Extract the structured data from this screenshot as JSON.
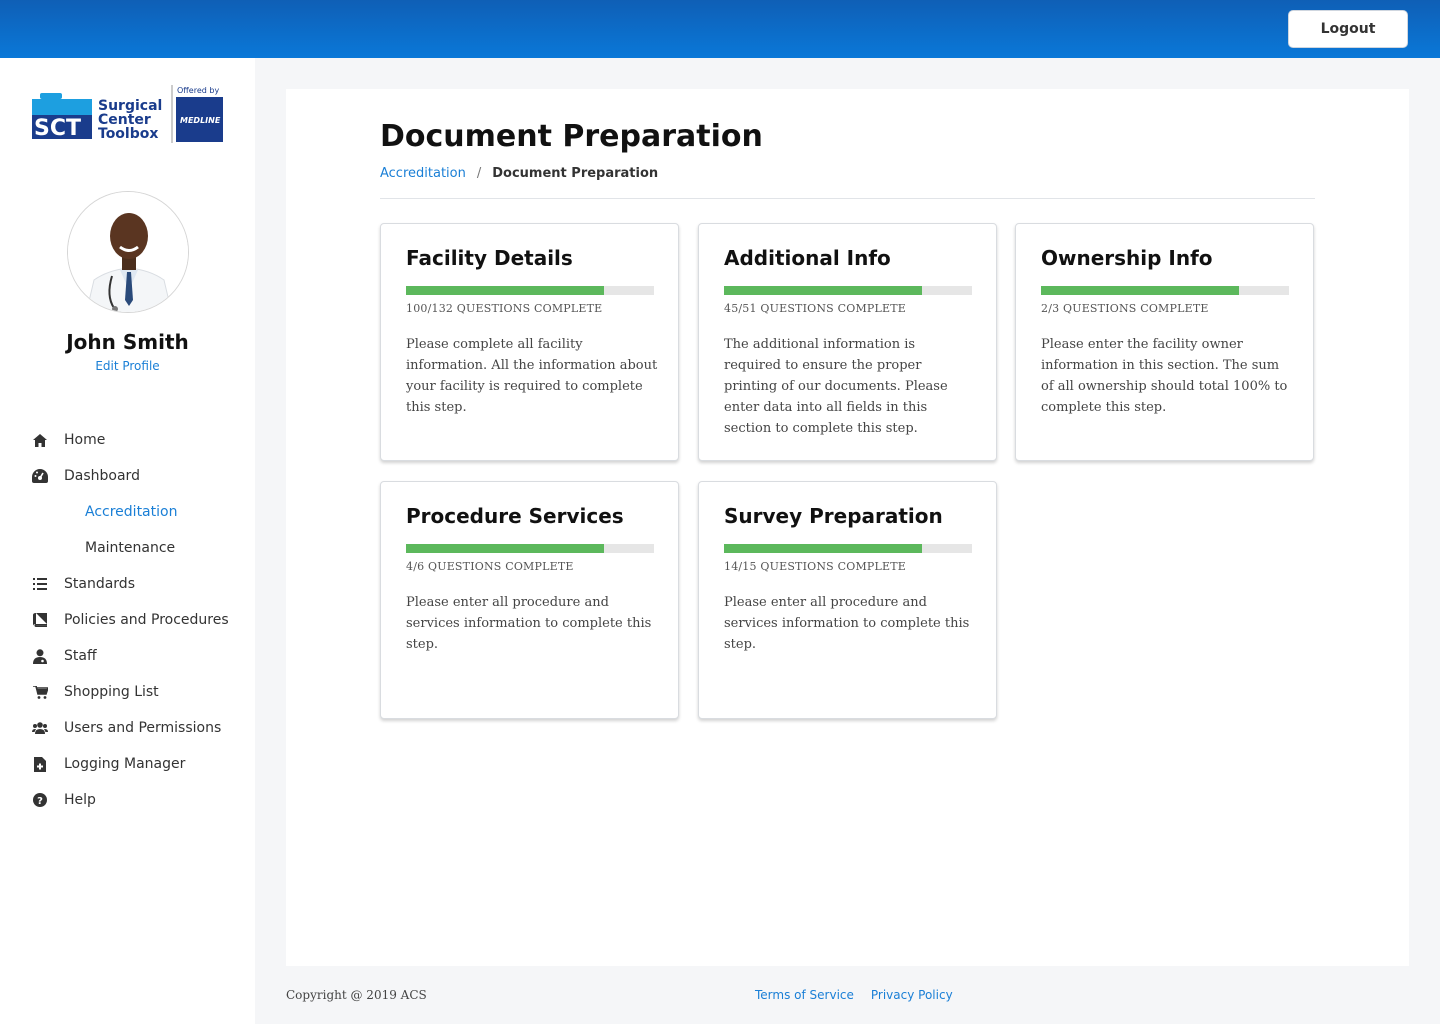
{
  "header": {
    "logout_label": "Logout"
  },
  "sidebar": {
    "logo": {
      "brand_line1": "Surgical",
      "brand_line2": "Center",
      "brand_line3": "Toolbox",
      "brand_initials": "SCT",
      "offered_by": "Offered by",
      "partner": "MEDLINE"
    },
    "user": {
      "name": "John Smith",
      "edit_profile_label": "Edit Profile"
    },
    "nav": [
      {
        "label": "Home",
        "icon": "home-icon"
      },
      {
        "label": "Dashboard",
        "icon": "dashboard-icon"
      },
      {
        "label": "Accreditation",
        "sub": true,
        "active": true
      },
      {
        "label": "Maintenance",
        "sub": true
      },
      {
        "label": "Standards",
        "icon": "list-icon"
      },
      {
        "label": "Policies and Procedures",
        "icon": "book-icon"
      },
      {
        "label": "Staff",
        "icon": "staff-icon"
      },
      {
        "label": "Shopping List",
        "icon": "cart-icon"
      },
      {
        "label": "Users and Permissions",
        "icon": "users-icon"
      },
      {
        "label": "Logging Manager",
        "icon": "file-plus-icon"
      },
      {
        "label": "Help",
        "icon": "help-icon"
      }
    ]
  },
  "main": {
    "title": "Document Preparation",
    "breadcrumb": {
      "parent": "Accreditation",
      "separator": "/",
      "current": "Document Preparation"
    },
    "cards": [
      {
        "title": "Facility Details",
        "count": "100/132 QUESTIONS COMPLETE",
        "progress": 0.8,
        "description": "Please complete all facility information. All the information about your facility is required to complete this step."
      },
      {
        "title": "Additional Info",
        "count": "45/51 QUESTIONS COMPLETE",
        "progress": 0.8,
        "description": "The additional information is required to ensure the proper printing of our documents. Please enter data into all fields in this section to complete this step."
      },
      {
        "title": "Ownership Info",
        "count": "2/3 QUESTIONS COMPLETE",
        "progress": 0.8,
        "description": "Please enter the facility owner information in this section. The sum of all ownership should total 100% to complete this step."
      },
      {
        "title": "Procedure Services",
        "count": "4/6 QUESTIONS COMPLETE",
        "progress": 0.8,
        "description": "Please enter all procedure and services information to complete this step."
      },
      {
        "title": "Survey Preparation",
        "count": "14/15 QUESTIONS COMPLETE",
        "progress": 0.8,
        "description": "Please enter all procedure and services information to complete this step."
      }
    ]
  },
  "footer": {
    "copyright": "Copyright @ 2019 ACS",
    "terms_label": "Terms of Service",
    "privacy_label": "Privacy Policy"
  },
  "colors": {
    "accent": "#1a7fd6",
    "progress": "#5cb85c",
    "header": "#0a78d8"
  }
}
